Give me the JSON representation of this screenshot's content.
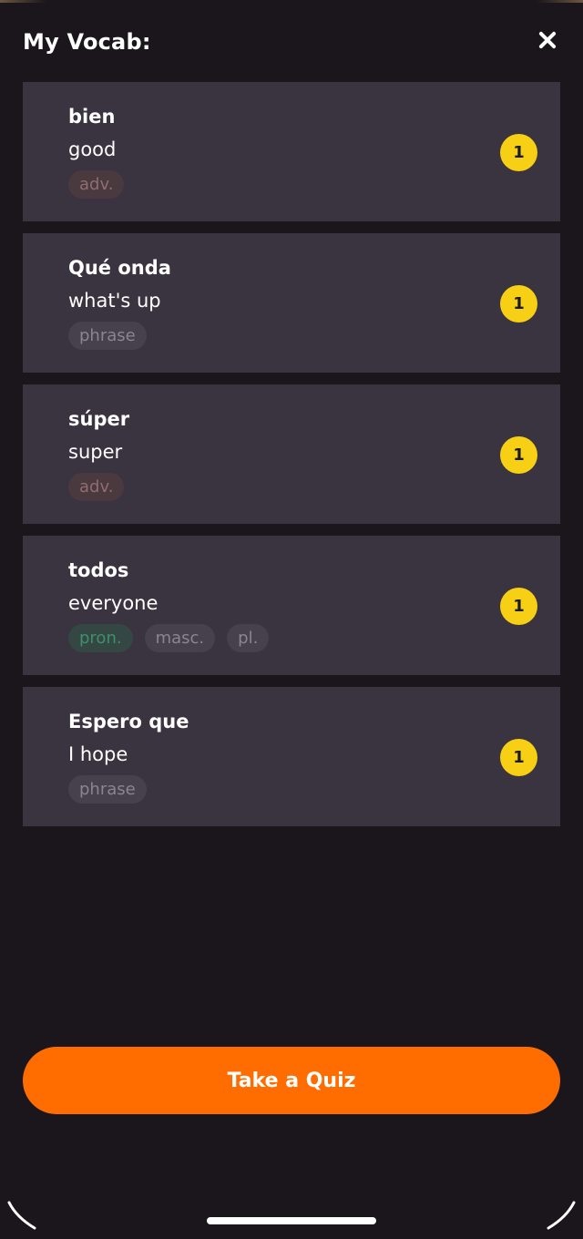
{
  "header": {
    "title": "My Vocab:",
    "close_icon": "close-icon"
  },
  "vocab": [
    {
      "word": "bien",
      "translation": "good",
      "count": "1",
      "tags": [
        {
          "label": "adv.",
          "kind": "adv"
        }
      ]
    },
    {
      "word": "Qué onda",
      "translation": "what's up",
      "count": "1",
      "tags": [
        {
          "label": "phrase",
          "kind": "gray"
        }
      ]
    },
    {
      "word": "súper",
      "translation": "super",
      "count": "1",
      "tags": [
        {
          "label": "adv.",
          "kind": "adv"
        }
      ]
    },
    {
      "word": "todos",
      "translation": "everyone",
      "count": "1",
      "tags": [
        {
          "label": "pron.",
          "kind": "pron"
        },
        {
          "label": "masc.",
          "kind": "gray"
        },
        {
          "label": "pl.",
          "kind": "gray"
        }
      ]
    },
    {
      "word": "Espero que",
      "translation": "I hope",
      "count": "1",
      "tags": [
        {
          "label": "phrase",
          "kind": "gray"
        }
      ]
    }
  ],
  "quiz_button": {
    "label": "Take a Quiz"
  },
  "colors": {
    "background": "#1b161b",
    "card": "#3a3340",
    "badge": "#f7cf14",
    "accent": "#ff6d00"
  }
}
